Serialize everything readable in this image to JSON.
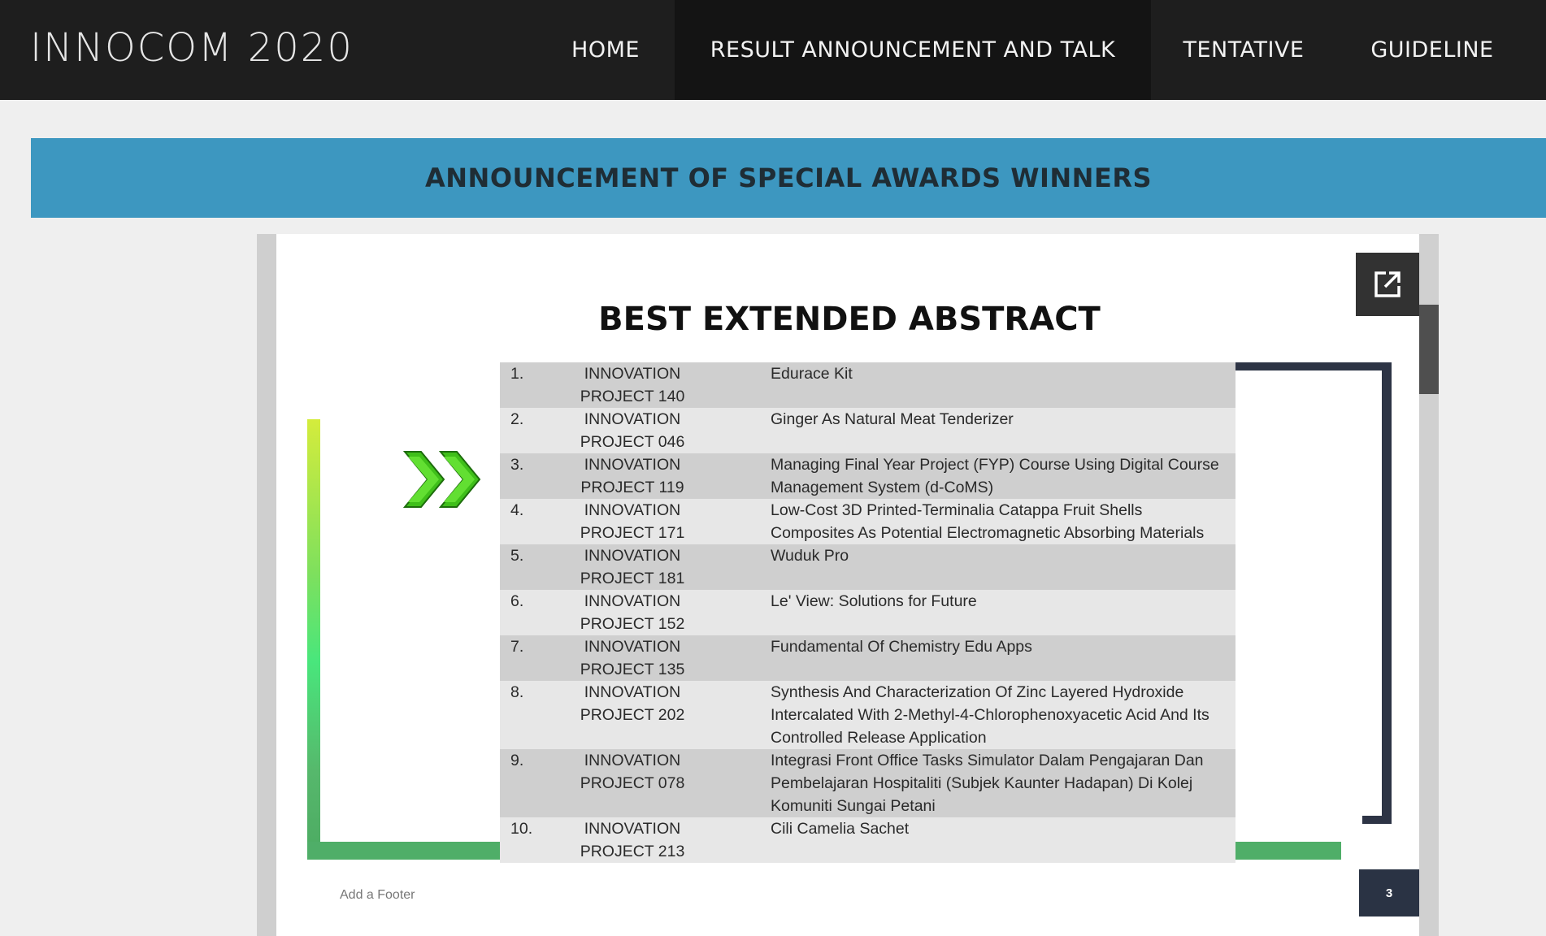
{
  "header": {
    "brand": "INNOCOM 2020",
    "nav": [
      {
        "label": "HOME"
      },
      {
        "label": "RESULT ANNOUNCEMENT AND TALK"
      },
      {
        "label": "TENTATIVE"
      },
      {
        "label": "GUIDELINE"
      }
    ]
  },
  "banner": {
    "title": "ANNOUNCEMENT OF SPECIAL AWARDS WINNERS"
  },
  "slide": {
    "title": "BEST EXTENDED ABSTRACT",
    "rows": [
      {
        "num": "1.",
        "project": "INNOVATION PROJECT 140",
        "title": "Edurace Kit"
      },
      {
        "num": "2.",
        "project": "INNOVATION PROJECT 046",
        "title": "Ginger As Natural Meat Tenderizer"
      },
      {
        "num": "3.",
        "project": "INNOVATION PROJECT 119",
        "title": "Managing Final Year Project (FYP) Course Using Digital Course Management System (d-CoMS)"
      },
      {
        "num": "4.",
        "project": "INNOVATION PROJECT 171",
        "title": "Low-Cost 3D Printed-Terminalia Catappa Fruit Shells Composites As Potential Electromagnetic Absorbing Materials"
      },
      {
        "num": "5.",
        "project": "INNOVATION PROJECT 181",
        "title": "Wuduk Pro"
      },
      {
        "num": "6.",
        "project": "INNOVATION PROJECT 152",
        "title": "Le' View: Solutions for Future"
      },
      {
        "num": "7.",
        "project": "INNOVATION PROJECT 135",
        "title": "Fundamental Of Chemistry Edu Apps"
      },
      {
        "num": "8.",
        "project": "INNOVATION PROJECT 202",
        "title": "Synthesis And Characterization Of Zinc Layered Hydroxide Intercalated With 2-Methyl-4-Chlorophenoxyacetic Acid And Its Controlled Release Application"
      },
      {
        "num": "9.",
        "project": "INNOVATION PROJECT 078",
        "title": "Integrasi Front Office Tasks Simulator Dalam Pengajaran Dan Pembelajaran Hospitaliti (Subjek Kaunter Hadapan) Di Kolej Komuniti Sungai Petani"
      },
      {
        "num": "10.",
        "project": "INNOVATION PROJECT 213",
        "title": "Cili Camelia Sachet"
      }
    ],
    "footer": "Add a Footer",
    "page_number": "3"
  },
  "icons": {
    "popout": "open-in-new-icon",
    "pointer": "double-chevron-right-icon"
  },
  "colors": {
    "topbar": "#1e1e1e",
    "banner": "#3d97c0",
    "accent_green": "#4fae68",
    "navy": "#2d3445"
  }
}
